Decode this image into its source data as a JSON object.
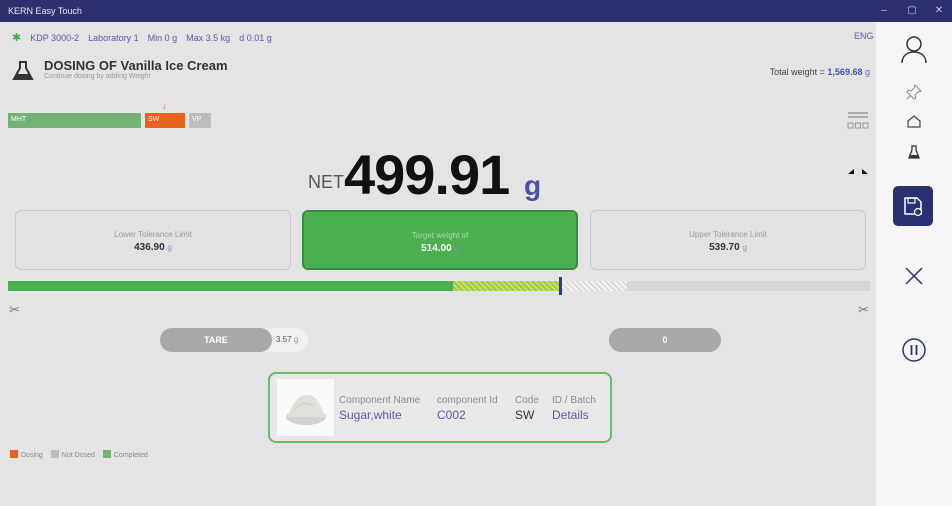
{
  "window": {
    "title": "KERN Easy Touch",
    "controls": [
      "–",
      "▢",
      "✕"
    ]
  },
  "header": {
    "device": "KDP 3000-2",
    "lab": "Laboratory 1",
    "min": "Min 0 g",
    "max": "Max 3.5 kg",
    "d": "d 0.01 g",
    "language": "ENG"
  },
  "dosing": {
    "title": "DOSING OF Vanilla Ice Cream",
    "subtitle": "Continue dosing by adding Weight",
    "total_label": "Total weight =",
    "total_value": "1,569.68",
    "total_unit": "g"
  },
  "segments": [
    {
      "label": "MHT",
      "color": "#74b277"
    },
    {
      "label": "SW",
      "color": "#e8641e"
    },
    {
      "label": "VP",
      "color": "#bdbdbd"
    }
  ],
  "reading": {
    "prefix": "NET",
    "value": "499.91",
    "unit": "g"
  },
  "tolerance": {
    "lower": {
      "label": "Lower Tolerance Limit",
      "value": "436.90",
      "unit": "g"
    },
    "target": {
      "label": "Target weight of",
      "value": "514.00",
      "unit": "g"
    },
    "upper": {
      "label": "Upper Tolerance Limit",
      "value": "539.70",
      "unit": "g"
    }
  },
  "progress": {
    "green_fraction": 0.516,
    "hatch_end_fraction": 0.64,
    "check_end_fraction": 0.718,
    "marker_fraction": 0.64
  },
  "controls": {
    "tare_label": "TARE",
    "tare_value": "3.57",
    "tare_unit": "g",
    "zero_label": "0"
  },
  "component": {
    "headers": {
      "name": "Component Name",
      "id": "component Id",
      "code": "Code",
      "batch": "ID / Batch"
    },
    "values": {
      "name": "Sugar,white",
      "id": "C002",
      "code": "SW",
      "batch": "Details"
    }
  },
  "legend": [
    {
      "label": "Dosing",
      "color": "#e8641e"
    },
    {
      "label": "Not Dosed",
      "color": "#bdbdbd"
    },
    {
      "label": "Completed",
      "color": "#74b277"
    }
  ],
  "sidebar_icons": [
    "user-icon",
    "pin-icon",
    "home-icon",
    "flask-icon",
    "save-icon",
    "close-icon",
    "pause-icon"
  ]
}
